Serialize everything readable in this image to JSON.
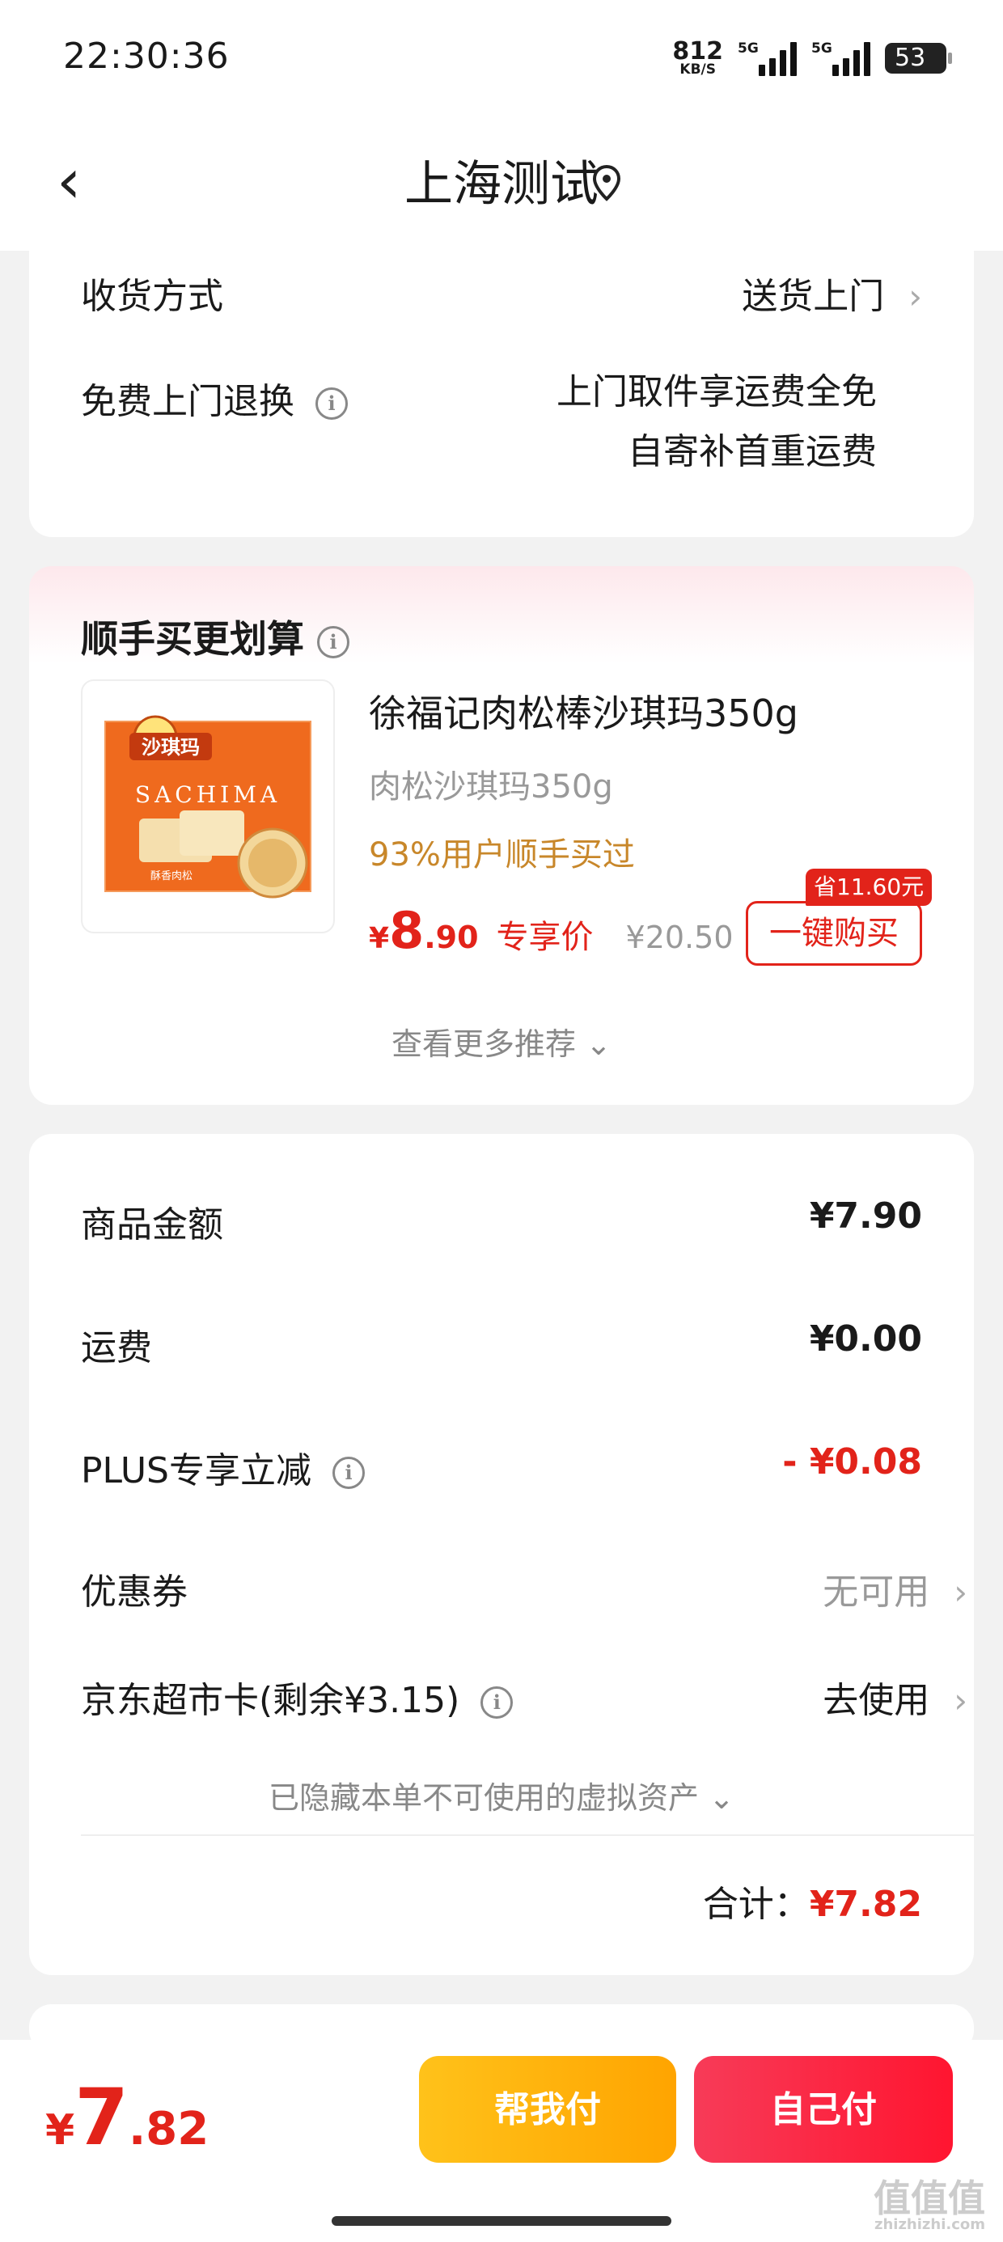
{
  "status": {
    "time": "22:30:36",
    "speed": "812",
    "speed_unit": "KB/S",
    "net1": "5G",
    "net2": "5G",
    "battery": "53"
  },
  "nav": {
    "back_icon": "chevron-left",
    "title": "上海测试",
    "location_icon": "map-pin"
  },
  "delivery": {
    "method_label": "收货方式",
    "method_value": "送货上门",
    "return_label": "免费上门退换",
    "return_line1": "上门取件享运费全免",
    "return_line2": "自寄补首重运费"
  },
  "recommend": {
    "title": "顺手买更划算",
    "product": {
      "name": "徐福记肉松棒沙琪玛350g",
      "subtitle": "肉松沙琪玛350g",
      "stat": "93%用户顺手买过",
      "price_symbol": "¥",
      "price_int": "8",
      "price_dec": ".90",
      "price_tag": "专享价",
      "original_price": "¥20.50",
      "save_badge": "省11.60元",
      "buy_button": "一键购买",
      "image_text_cn": "沙琪玛",
      "image_text_en": "SACHIMA",
      "image_text_flavor": "酥香肉松"
    },
    "more": "查看更多推荐"
  },
  "summary": {
    "goods_label": "商品金额",
    "goods_value": "¥7.90",
    "shipping_label": "运费",
    "shipping_value": "¥0.00",
    "plus_label": "PLUS专享立减",
    "plus_value": "- ¥0.08",
    "coupon_label": "优惠券",
    "coupon_value": "无可用",
    "card_label": "京东超市卡(剩余¥3.15)",
    "card_value": "去使用",
    "hidden_note": "已隐藏本单不可使用的虚拟资产",
    "total_label": "合计：",
    "total_value": "¥7.82"
  },
  "bottom": {
    "price_symbol": "¥",
    "price_int": "7",
    "price_dec": ".82",
    "help_pay": "帮我付",
    "self_pay": "自己付"
  },
  "watermark": {
    "text": "值值值",
    "sub": "zhizhizhi.com"
  },
  "colors": {
    "accent": "#e2231a",
    "help_btn": "#ffb20f",
    "self_btn": "#fa2a44",
    "stat": "#c8872a"
  }
}
